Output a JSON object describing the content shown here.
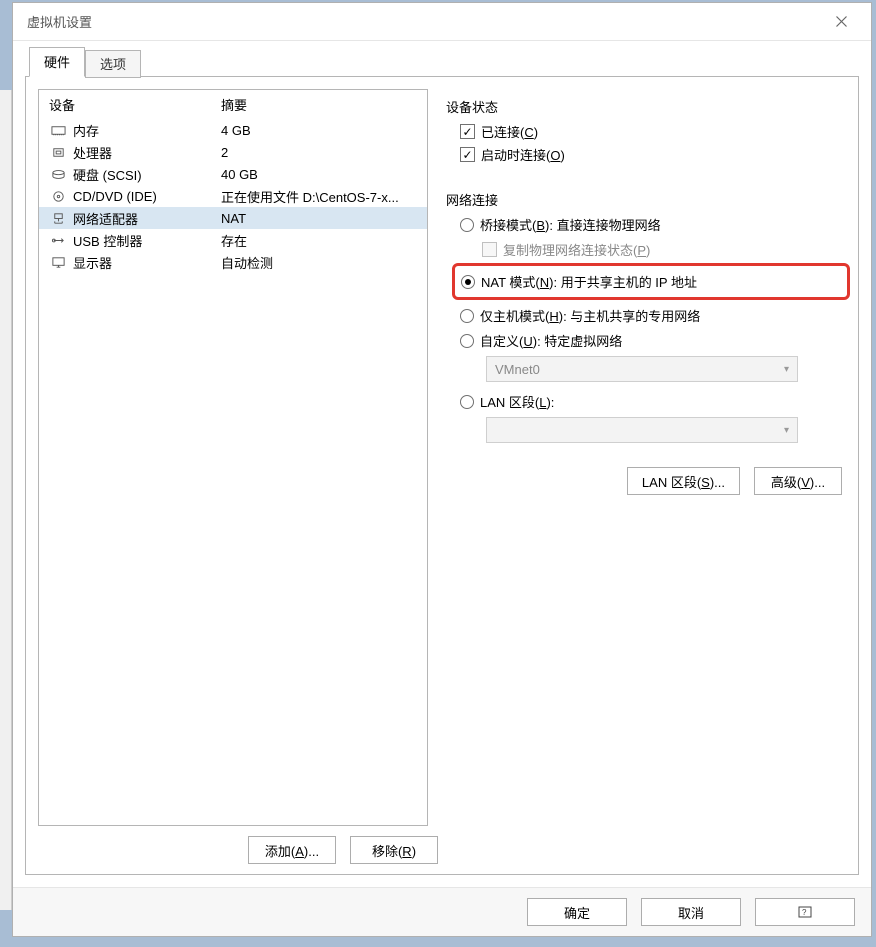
{
  "title": "虚拟机设置",
  "tabs": {
    "hardware": "硬件",
    "options": "选项"
  },
  "deviceList": {
    "header": {
      "device": "设备",
      "summary": "摘要"
    },
    "rows": [
      {
        "icon": "memory",
        "label": "内存",
        "summary": "4 GB"
      },
      {
        "icon": "cpu",
        "label": "处理器",
        "summary": "2"
      },
      {
        "icon": "disk",
        "label": "硬盘 (SCSI)",
        "summary": "40 GB"
      },
      {
        "icon": "cd",
        "label": "CD/DVD (IDE)",
        "summary": "正在使用文件 D:\\CentOS-7-x..."
      },
      {
        "icon": "network",
        "label": "网络适配器",
        "summary": "NAT"
      },
      {
        "icon": "usb",
        "label": "USB 控制器",
        "summary": "存在"
      },
      {
        "icon": "display",
        "label": "显示器",
        "summary": "自动检测"
      }
    ],
    "selectedIndex": 4
  },
  "buttons": {
    "add": "添加(A)...",
    "remove": "移除(R)",
    "lanSegments": "LAN 区段(S)...",
    "advanced": "高级(V)...",
    "ok": "确定",
    "cancel": "取消",
    "help": "帮助"
  },
  "rightPanel": {
    "deviceStatus": {
      "title": "设备状态",
      "connected": "已连接(C)",
      "connectAtPowerOn": "启动时连接(O)"
    },
    "networkConnection": {
      "title": "网络连接",
      "bridged": "桥接模式(B): 直接连接物理网络",
      "replicate": "复制物理网络连接状态(P)",
      "nat": "NAT 模式(N): 用于共享主机的 IP 地址",
      "hostOnly": "仅主机模式(H): 与主机共享的专用网络",
      "custom": "自定义(U): 特定虚拟网络",
      "customValue": "VMnet0",
      "lanSegment": "LAN 区段(L):"
    }
  }
}
